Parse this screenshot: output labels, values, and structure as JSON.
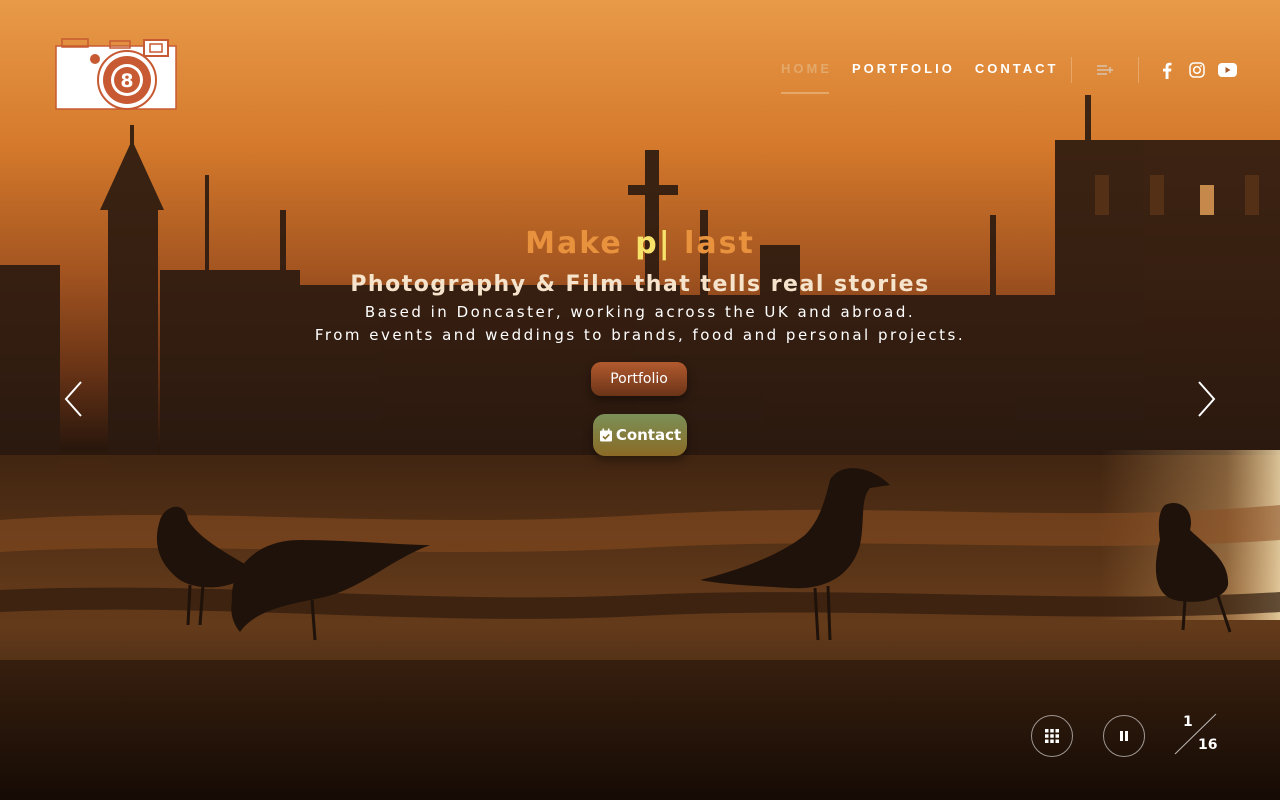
{
  "header": {
    "nav": [
      {
        "label": "HOME",
        "active": true
      },
      {
        "label": "PORTFOLIO",
        "active": false
      },
      {
        "label": "CONTACT",
        "active": false
      }
    ],
    "logo_number": "8"
  },
  "hero": {
    "title_prefix": "Make ",
    "title_typed": "p|",
    "title_suffix": " last",
    "subtitle": "Photography & Film that tells real stories",
    "description_line1": "Based in Doncaster, working across the UK and abroad.",
    "description_line2": "From events and weddings to brands, food and personal projects.",
    "portfolio_button": "Portfolio",
    "contact_button": "Contact"
  },
  "slider": {
    "current": "1",
    "total": "16"
  },
  "icons": {
    "menu": "menu-plus-icon",
    "social": [
      "facebook-icon",
      "instagram-icon",
      "youtube-icon"
    ],
    "controls": [
      "grid-icon",
      "pause-icon"
    ],
    "arrows": [
      "chevron-left-icon",
      "chevron-right-icon"
    ]
  },
  "colors": {
    "accent": "#e4a86b",
    "title": "#e8923d",
    "typed": "#f7e36a"
  }
}
